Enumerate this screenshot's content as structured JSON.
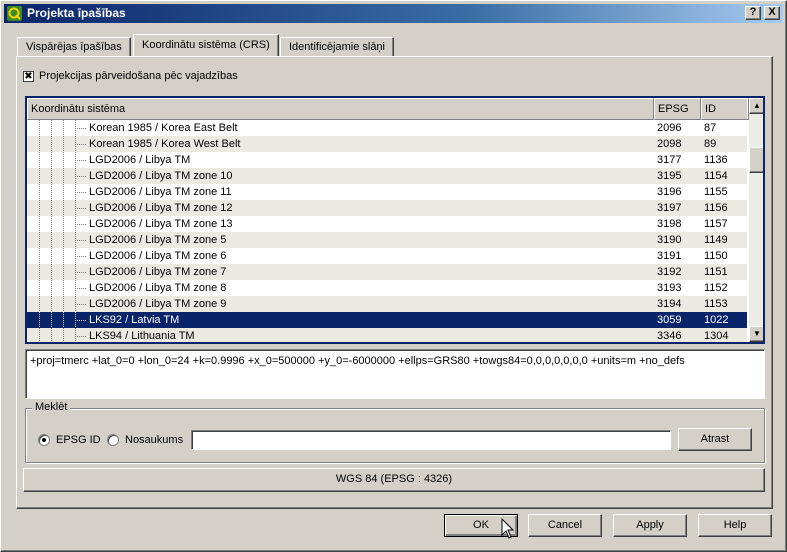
{
  "window": {
    "title": "Projekta īpašības",
    "help_label": "?",
    "close_label": "X"
  },
  "tabs": [
    {
      "label": "Vispārējas īpašības",
      "active": false
    },
    {
      "label": "Koordinātu sistēma (CRS)",
      "active": true
    },
    {
      "label": "Identificējamie slāņi",
      "active": false
    }
  ],
  "reprojection": {
    "label": "Projekcijas pārveidošana pēc vajadzības",
    "checked": true,
    "check_glyph": "✖"
  },
  "crs_tree": {
    "headers": {
      "name": "Koordinātu sistēma",
      "epsg": "EPSG",
      "id": "ID"
    },
    "rows": [
      {
        "name": "Korean 1985 / Korea East Belt",
        "epsg": "2096",
        "id": "87"
      },
      {
        "name": "Korean 1985 / Korea West Belt",
        "epsg": "2098",
        "id": "89"
      },
      {
        "name": "LGD2006 / Libya TM",
        "epsg": "3177",
        "id": "1136"
      },
      {
        "name": "LGD2006 / Libya TM zone 10",
        "epsg": "3195",
        "id": "1154"
      },
      {
        "name": "LGD2006 / Libya TM zone 11",
        "epsg": "3196",
        "id": "1155"
      },
      {
        "name": "LGD2006 / Libya TM zone 12",
        "epsg": "3197",
        "id": "1156"
      },
      {
        "name": "LGD2006 / Libya TM zone 13",
        "epsg": "3198",
        "id": "1157"
      },
      {
        "name": "LGD2006 / Libya TM zone 5",
        "epsg": "3190",
        "id": "1149"
      },
      {
        "name": "LGD2006 / Libya TM zone 6",
        "epsg": "3191",
        "id": "1150"
      },
      {
        "name": "LGD2006 / Libya TM zone 7",
        "epsg": "3192",
        "id": "1151"
      },
      {
        "name": "LGD2006 / Libya TM zone 8",
        "epsg": "3193",
        "id": "1152"
      },
      {
        "name": "LGD2006 / Libya TM zone 9",
        "epsg": "3194",
        "id": "1153"
      },
      {
        "name": "LKS92 / Latvia TM",
        "epsg": "3059",
        "id": "1022",
        "selected": true
      },
      {
        "name": "LKS94 / Lithuania TM",
        "epsg": "3346",
        "id": "1304"
      }
    ],
    "scroll_up": "▲",
    "scroll_down": "▼"
  },
  "proj_string": "+proj=tmerc +lat_0=0 +lon_0=24 +k=0.9996 +x_0=500000 +y_0=-6000000 +ellps=GRS80 +towgs84=0,0,0,0,0,0,0 +units=m +no_defs",
  "search": {
    "group_title": "Meklēt",
    "option_epsg": "EPSG ID",
    "option_name": "Nosaukums",
    "selected": "epsg",
    "value": "",
    "find_label": "Atrast"
  },
  "current_crs": "WGS 84 (EPSG : 4326)",
  "buttons": {
    "ok": "OK",
    "cancel": "Cancel",
    "apply": "Apply",
    "help": "Help"
  },
  "colors": {
    "selection": "#0a246a",
    "title_gradient_start": "#0a246a",
    "title_gradient_end": "#a6caf0",
    "dialog_face": "#d4d0c8"
  }
}
